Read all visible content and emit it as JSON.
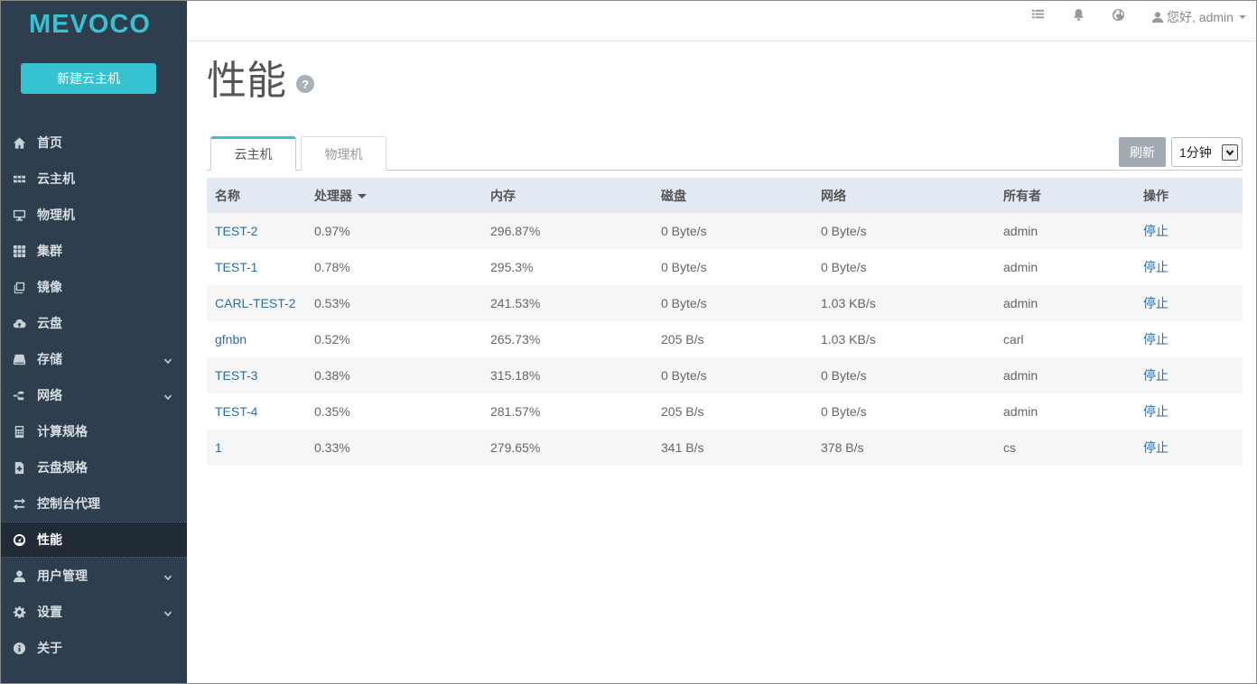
{
  "brand": {
    "logo": "MEVOCO",
    "color": "#36c2d0"
  },
  "sidebar": {
    "new_vm_label": "新建云主机",
    "items": [
      {
        "label": "首页",
        "icon": "home-icon",
        "expandable": false,
        "active": false
      },
      {
        "label": "云主机",
        "icon": "grid-icon",
        "expandable": false,
        "active": false
      },
      {
        "label": "物理机",
        "icon": "monitor-icon",
        "expandable": false,
        "active": false
      },
      {
        "label": "集群",
        "icon": "cluster-icon",
        "expandable": false,
        "active": false
      },
      {
        "label": "镜像",
        "icon": "image-icon",
        "expandable": false,
        "active": false
      },
      {
        "label": "云盘",
        "icon": "cloud-icon",
        "expandable": false,
        "active": false
      },
      {
        "label": "存储",
        "icon": "storage-icon",
        "expandable": true,
        "active": false
      },
      {
        "label": "网络",
        "icon": "network-icon",
        "expandable": true,
        "active": false
      },
      {
        "label": "计算规格",
        "icon": "calculator-icon",
        "expandable": false,
        "active": false
      },
      {
        "label": "云盘规格",
        "icon": "disk-offering-icon",
        "expandable": false,
        "active": false
      },
      {
        "label": "控制台代理",
        "icon": "swap-icon",
        "expandable": false,
        "active": false
      },
      {
        "label": "性能",
        "icon": "dashboard-icon",
        "expandable": false,
        "active": true
      },
      {
        "label": "用户管理",
        "icon": "user-icon",
        "expandable": true,
        "active": false
      },
      {
        "label": "设置",
        "icon": "gear-icon",
        "expandable": true,
        "active": false
      },
      {
        "label": "关于",
        "icon": "info-icon",
        "expandable": false,
        "active": false
      }
    ]
  },
  "topbar": {
    "icons": [
      "list-icon",
      "bell-icon",
      "globe-icon"
    ],
    "user_label": "您好, admin"
  },
  "main": {
    "title": "性能",
    "tabs": [
      {
        "label": "云主机",
        "active": true
      },
      {
        "label": "物理机",
        "active": false
      }
    ],
    "refresh_label": "刷新",
    "interval_value": "1分钟",
    "table": {
      "columns": [
        "名称",
        "处理器",
        "内存",
        "磁盘",
        "网络",
        "所有者",
        "操作"
      ],
      "sorted_column": "处理器",
      "rows": [
        {
          "name": "TEST-2",
          "cpu": "0.97%",
          "memory": "296.87%",
          "disk": "0 Byte/s",
          "network": "0 Byte/s",
          "owner": "admin",
          "action": "停止"
        },
        {
          "name": "TEST-1",
          "cpu": "0.78%",
          "memory": "295.3%",
          "disk": "0 Byte/s",
          "network": "0 Byte/s",
          "owner": "admin",
          "action": "停止"
        },
        {
          "name": "CARL-TEST-2",
          "cpu": "0.53%",
          "memory": "241.53%",
          "disk": "0 Byte/s",
          "network": "1.03 KB/s",
          "owner": "admin",
          "action": "停止"
        },
        {
          "name": "gfnbn",
          "cpu": "0.52%",
          "memory": "265.73%",
          "disk": "205 B/s",
          "network": "1.03 KB/s",
          "owner": "carl",
          "action": "停止"
        },
        {
          "name": "TEST-3",
          "cpu": "0.38%",
          "memory": "315.18%",
          "disk": "0 Byte/s",
          "network": "0 Byte/s",
          "owner": "admin",
          "action": "停止"
        },
        {
          "name": "TEST-4",
          "cpu": "0.35%",
          "memory": "281.57%",
          "disk": "205 B/s",
          "network": "0 Byte/s",
          "owner": "admin",
          "action": "停止"
        },
        {
          "name": "1",
          "cpu": "0.33%",
          "memory": "279.65%",
          "disk": "341 B/s",
          "network": "378 B/s",
          "owner": "cs",
          "action": "停止"
        }
      ]
    }
  }
}
